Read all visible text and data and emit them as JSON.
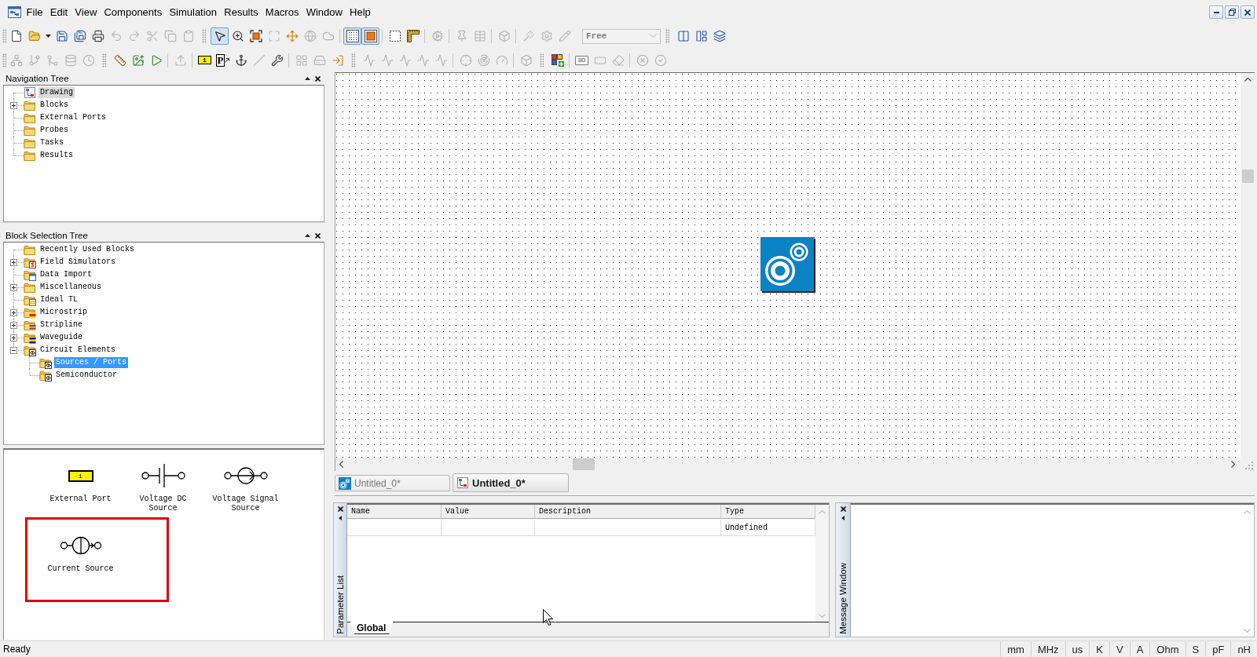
{
  "menu_bar": {
    "items": [
      "File",
      "Edit",
      "View",
      "Components",
      "Simulation",
      "Results",
      "Macros",
      "Window",
      "Help"
    ]
  },
  "toolbars": [
    {
      "items": [
        {
          "kind": "grip"
        },
        {
          "kind": "button",
          "disabled": false,
          "pressed": false
        },
        {
          "kind": "split",
          "disabled": false,
          "pressed": false
        },
        {
          "kind": "button",
          "disabled": false,
          "pressed": false
        },
        {
          "kind": "button",
          "disabled": false,
          "pressed": false
        },
        {
          "kind": "button",
          "disabled": false,
          "pressed": false
        },
        {
          "kind": "button",
          "disabled": true,
          "pressed": false
        },
        {
          "kind": "button",
          "disabled": true,
          "pressed": false
        },
        {
          "kind": "button",
          "disabled": true,
          "pressed": false
        },
        {
          "kind": "button",
          "disabled": true,
          "pressed": false
        },
        {
          "kind": "button",
          "disabled": true,
          "pressed": false
        },
        {
          "kind": "grip"
        },
        {
          "kind": "button",
          "disabled": false,
          "pressed": true
        },
        {
          "kind": "button",
          "disabled": false,
          "pressed": false
        },
        {
          "kind": "button",
          "disabled": false,
          "pressed": false
        },
        {
          "kind": "button",
          "disabled": true,
          "pressed": false
        },
        {
          "kind": "button",
          "disabled": false,
          "pressed": false
        },
        {
          "kind": "button",
          "disabled": true,
          "pressed": false
        },
        {
          "kind": "button",
          "disabled": true,
          "pressed": false
        },
        {
          "kind": "separator"
        },
        {
          "kind": "button",
          "disabled": false,
          "pressed": true
        },
        {
          "kind": "button",
          "disabled": false,
          "pressed": true
        },
        {
          "kind": "separator"
        },
        {
          "kind": "button",
          "disabled": false,
          "pressed": false
        },
        {
          "kind": "button",
          "disabled": false,
          "pressed": false
        },
        {
          "kind": "separator"
        },
        {
          "kind": "button",
          "disabled": true,
          "pressed": false
        },
        {
          "kind": "separator"
        },
        {
          "kind": "button",
          "disabled": true,
          "pressed": false
        },
        {
          "kind": "button",
          "disabled": true,
          "pressed": false
        },
        {
          "kind": "separator"
        },
        {
          "kind": "button",
          "disabled": true,
          "pressed": false
        },
        {
          "kind": "separator"
        },
        {
          "kind": "button",
          "disabled": true,
          "pressed": false
        },
        {
          "kind": "button",
          "disabled": true,
          "pressed": false
        },
        {
          "kind": "button",
          "disabled": true,
          "pressed": false
        },
        {
          "kind": "dropdown",
          "value": "Free",
          "disabled": true
        },
        {
          "kind": "grip"
        },
        {
          "kind": "button",
          "disabled": false,
          "pressed": false
        },
        {
          "kind": "button",
          "disabled": false,
          "pressed": false
        },
        {
          "kind": "button",
          "disabled": false,
          "pressed": false
        }
      ]
    },
    {
      "items": [
        {
          "kind": "grip"
        },
        {
          "kind": "button",
          "disabled": true,
          "pressed": false
        },
        {
          "kind": "button",
          "disabled": true,
          "pressed": false
        },
        {
          "kind": "button",
          "disabled": true,
          "pressed": false
        },
        {
          "kind": "button",
          "disabled": true,
          "pressed": false
        },
        {
          "kind": "button",
          "disabled": true,
          "pressed": false
        },
        {
          "kind": "grip"
        },
        {
          "kind": "button",
          "disabled": false,
          "pressed": false
        },
        {
          "kind": "button",
          "disabled": false,
          "pressed": false
        },
        {
          "kind": "button",
          "disabled": false,
          "pressed": false
        },
        {
          "kind": "separator"
        },
        {
          "kind": "button",
          "disabled": true,
          "pressed": false
        },
        {
          "kind": "separator"
        },
        {
          "kind": "button",
          "disabled": false,
          "pressed": false,
          "text": "1"
        },
        {
          "kind": "button",
          "disabled": false,
          "pressed": false,
          "text": "P"
        },
        {
          "kind": "button",
          "disabled": false,
          "pressed": false
        },
        {
          "kind": "button",
          "disabled": true,
          "pressed": false
        },
        {
          "kind": "button",
          "disabled": false,
          "pressed": false
        },
        {
          "kind": "separator"
        },
        {
          "kind": "button",
          "disabled": true,
          "pressed": false
        },
        {
          "kind": "button",
          "disabled": true,
          "pressed": false
        },
        {
          "kind": "button",
          "disabled": false,
          "pressed": false
        },
        {
          "kind": "grip"
        },
        {
          "kind": "button",
          "disabled": true,
          "pressed": false
        },
        {
          "kind": "button",
          "disabled": true,
          "pressed": false
        },
        {
          "kind": "button",
          "disabled": true,
          "pressed": false
        },
        {
          "kind": "button",
          "disabled": true,
          "pressed": false
        },
        {
          "kind": "button",
          "disabled": true,
          "pressed": false
        },
        {
          "kind": "separator"
        },
        {
          "kind": "button",
          "disabled": true,
          "pressed": false
        },
        {
          "kind": "button",
          "disabled": true,
          "pressed": false
        },
        {
          "kind": "button",
          "disabled": true,
          "pressed": false
        },
        {
          "kind": "separator"
        },
        {
          "kind": "button",
          "disabled": true,
          "pressed": false
        },
        {
          "kind": "grip"
        },
        {
          "kind": "button",
          "disabled": false,
          "pressed": false
        },
        {
          "kind": "separator"
        },
        {
          "kind": "button",
          "disabled": true,
          "pressed": false,
          "text": "3D"
        },
        {
          "kind": "button",
          "disabled": true,
          "pressed": false
        },
        {
          "kind": "button",
          "disabled": true,
          "pressed": false
        },
        {
          "kind": "separator"
        },
        {
          "kind": "button",
          "disabled": true,
          "pressed": false
        },
        {
          "kind": "button",
          "disabled": true,
          "pressed": false
        }
      ]
    }
  ],
  "navigation_tree": {
    "title": "Navigation Tree",
    "focused": false,
    "items": [
      {
        "label": "Drawing",
        "kind": "drawing",
        "selected": true
      },
      {
        "label": "Blocks",
        "kind": "folder",
        "selected": false,
        "expanded": false
      },
      {
        "label": "External Ports",
        "kind": "folder",
        "selected": false
      },
      {
        "label": "Probes",
        "kind": "folder",
        "selected": false
      },
      {
        "label": "Tasks",
        "kind": "folder",
        "selected": false
      },
      {
        "label": "Results",
        "kind": "folder",
        "selected": false
      }
    ]
  },
  "block_selection_tree": {
    "title": "Block Selection Tree",
    "focused": true,
    "items": [
      {
        "label": "Recently Used Blocks",
        "kind": "folder",
        "selected": false
      },
      {
        "label": "Field Simulators",
        "kind": "simulators",
        "selected": false,
        "expanded": false
      },
      {
        "label": "Data Import",
        "kind": "import",
        "selected": false
      },
      {
        "label": "Miscellaneous",
        "kind": "folder",
        "selected": false,
        "expanded": false
      },
      {
        "label": "Ideal TL",
        "kind": "ideal",
        "selected": false
      },
      {
        "label": "Microstrip",
        "kind": "microstrip",
        "selected": false,
        "expanded": false
      },
      {
        "label": "Stripline",
        "kind": "stripline",
        "selected": false,
        "expanded": false
      },
      {
        "label": "Waveguide",
        "kind": "waveguide",
        "selected": false,
        "expanded": false
      },
      {
        "label": "Circuit Elements",
        "kind": "circuit",
        "selected": false,
        "expanded": true,
        "children": [
          {
            "label": "Sources / Ports",
            "kind": "circuit",
            "selected": true
          },
          {
            "label": "Semiconductor",
            "kind": "circuit",
            "selected": false
          }
        ]
      }
    ]
  },
  "block_palette": {
    "items": [
      {
        "kind": "port",
        "label": "External Port",
        "port_number": "1",
        "highlighted": false
      },
      {
        "kind": "dc",
        "label": "Voltage DC Source",
        "highlighted": false
      },
      {
        "kind": "signal",
        "label": "Voltage Signal Source",
        "highlighted": false
      },
      {
        "kind": "current",
        "label": "Current Source",
        "highlighted": true
      }
    ]
  },
  "document_tabs": [
    {
      "label": "Untitled_0*",
      "kind": "block",
      "selected": false
    },
    {
      "label": "Untitled_0*",
      "kind": "drawing",
      "selected": true
    }
  ],
  "parameter_list": {
    "title": "Parameter List",
    "columns": [
      "Name",
      "Value",
      "Description",
      "Type"
    ],
    "rows": [
      {
        "type": "Undefined"
      }
    ],
    "tabs": [
      {
        "label": "Global",
        "selected": true
      }
    ]
  },
  "message_window": {
    "title": "Message Window"
  },
  "status_bar": {
    "message": "Ready",
    "units": [
      "mm",
      "MHz",
      "us",
      "K",
      "V",
      "A",
      "Ohm",
      "S",
      "pF",
      "nH"
    ]
  }
}
